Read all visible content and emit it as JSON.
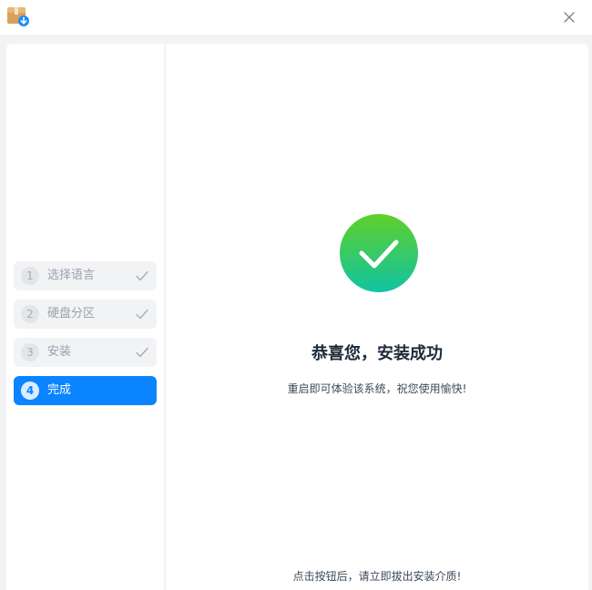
{
  "window": {
    "icon": "installer-package-icon",
    "close_icon": "close-icon"
  },
  "sidebar": {
    "steps": [
      {
        "number": "1",
        "label": "选择语言",
        "state": "done"
      },
      {
        "number": "2",
        "label": "硬盘分区",
        "state": "done"
      },
      {
        "number": "3",
        "label": "安装",
        "state": "done"
      },
      {
        "number": "4",
        "label": "完成",
        "state": "active"
      }
    ]
  },
  "main": {
    "icon": "success-check-icon",
    "title": "恭喜您，安装成功",
    "subtitle": "重启即可体验该系统，祝您使用愉快!",
    "footer_note": "点击按钮后，请立即拔出安装介质!"
  },
  "colors": {
    "accent": "#0a84ff",
    "success_top": "#5fd02a",
    "success_bottom": "#11c3a2"
  }
}
